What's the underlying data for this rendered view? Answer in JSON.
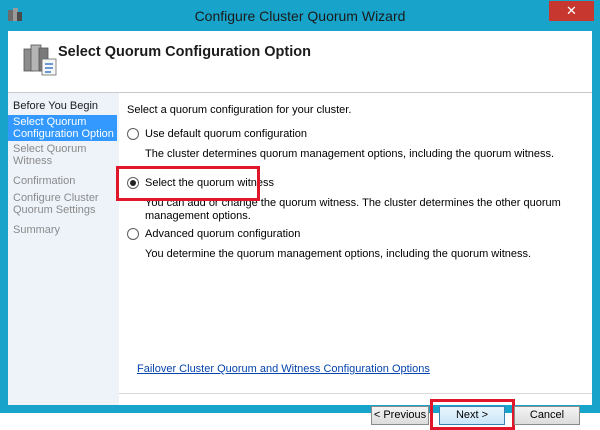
{
  "window": {
    "title": "Configure Cluster Quorum Wizard",
    "close_glyph": "✕"
  },
  "header": {
    "title": "Select Quorum Configuration Option",
    "icon": "cluster-servers-icon"
  },
  "sidebar": {
    "items": [
      {
        "label": "Before You Begin",
        "state": "done"
      },
      {
        "label": "Select Quorum Configuration Option",
        "state": "active"
      },
      {
        "label": "Select Quorum Witness",
        "state": "pending"
      },
      {
        "label": "Confirmation",
        "state": "pending"
      },
      {
        "label": "Configure Cluster Quorum Settings",
        "state": "pending"
      },
      {
        "label": "Summary",
        "state": "pending"
      }
    ]
  },
  "content": {
    "intro": "Select a quorum configuration for your cluster.",
    "options": [
      {
        "label": "Use default quorum configuration",
        "description": "The cluster determines quorum management options, including the quorum witness.",
        "selected": false
      },
      {
        "label": "Select the quorum witness",
        "description": "You can add or change the quorum witness. The cluster determines the other quorum management options.",
        "selected": true
      },
      {
        "label": "Advanced quorum configuration",
        "description": "You determine the quorum management options, including the quorum witness.",
        "selected": false
      }
    ],
    "help_link": "Failover Cluster Quorum and Witness Configuration Options"
  },
  "buttons": {
    "previous": "< Previous",
    "next": "Next >",
    "cancel": "Cancel"
  },
  "colors": {
    "titlebar": "#17a3ca",
    "highlight": "#e0162b",
    "sidebar_active": "#3399ff",
    "link": "#0645ad"
  }
}
